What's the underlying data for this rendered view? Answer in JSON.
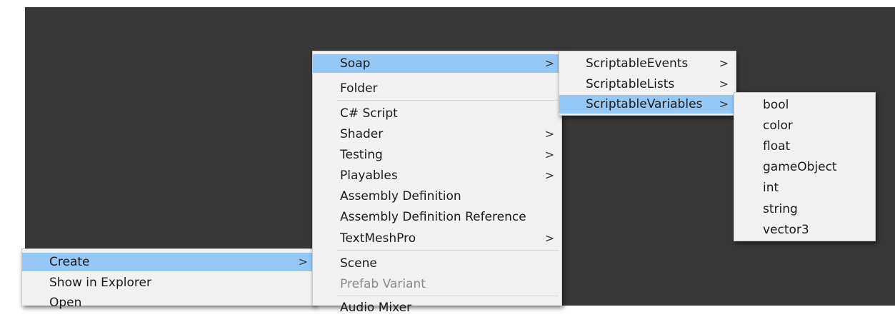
{
  "create_menu": {
    "items": [
      {
        "label": "Create",
        "has_submenu": true,
        "arrow": ">",
        "highlighted": true
      },
      {
        "label": "Show in Explorer"
      },
      {
        "label": "Open"
      }
    ]
  },
  "create_submenu": {
    "items": [
      {
        "label": "Soap",
        "arrow": ">",
        "highlighted": true
      },
      {
        "label": "Folder"
      },
      {
        "label": "C# Script"
      },
      {
        "label": "Shader",
        "arrow": ">"
      },
      {
        "label": "Testing",
        "arrow": ">"
      },
      {
        "label": "Playables",
        "arrow": ">"
      },
      {
        "label": "Assembly Definition"
      },
      {
        "label": "Assembly Definition Reference"
      },
      {
        "label": "TextMeshPro",
        "arrow": ">"
      },
      {
        "label": "Scene"
      },
      {
        "label": "Prefab Variant",
        "disabled": true
      },
      {
        "label": "Audio Mixer"
      }
    ]
  },
  "soap_submenu": {
    "items": [
      {
        "label": "ScriptableEvents",
        "arrow": ">"
      },
      {
        "label": "ScriptableLists",
        "arrow": ">"
      },
      {
        "label": "ScriptableVariables",
        "arrow": ">",
        "highlighted": true
      }
    ]
  },
  "variables_submenu": {
    "items": [
      {
        "label": "bool"
      },
      {
        "label": "color"
      },
      {
        "label": "float"
      },
      {
        "label": "gameObject"
      },
      {
        "label": "int"
      },
      {
        "label": "string"
      },
      {
        "label": "vector3"
      }
    ]
  },
  "colors": {
    "background": "#383838",
    "menu_bg": "#f2f2f2",
    "highlight": "#96c8f6",
    "disabled_text": "#8a8a8a"
  }
}
